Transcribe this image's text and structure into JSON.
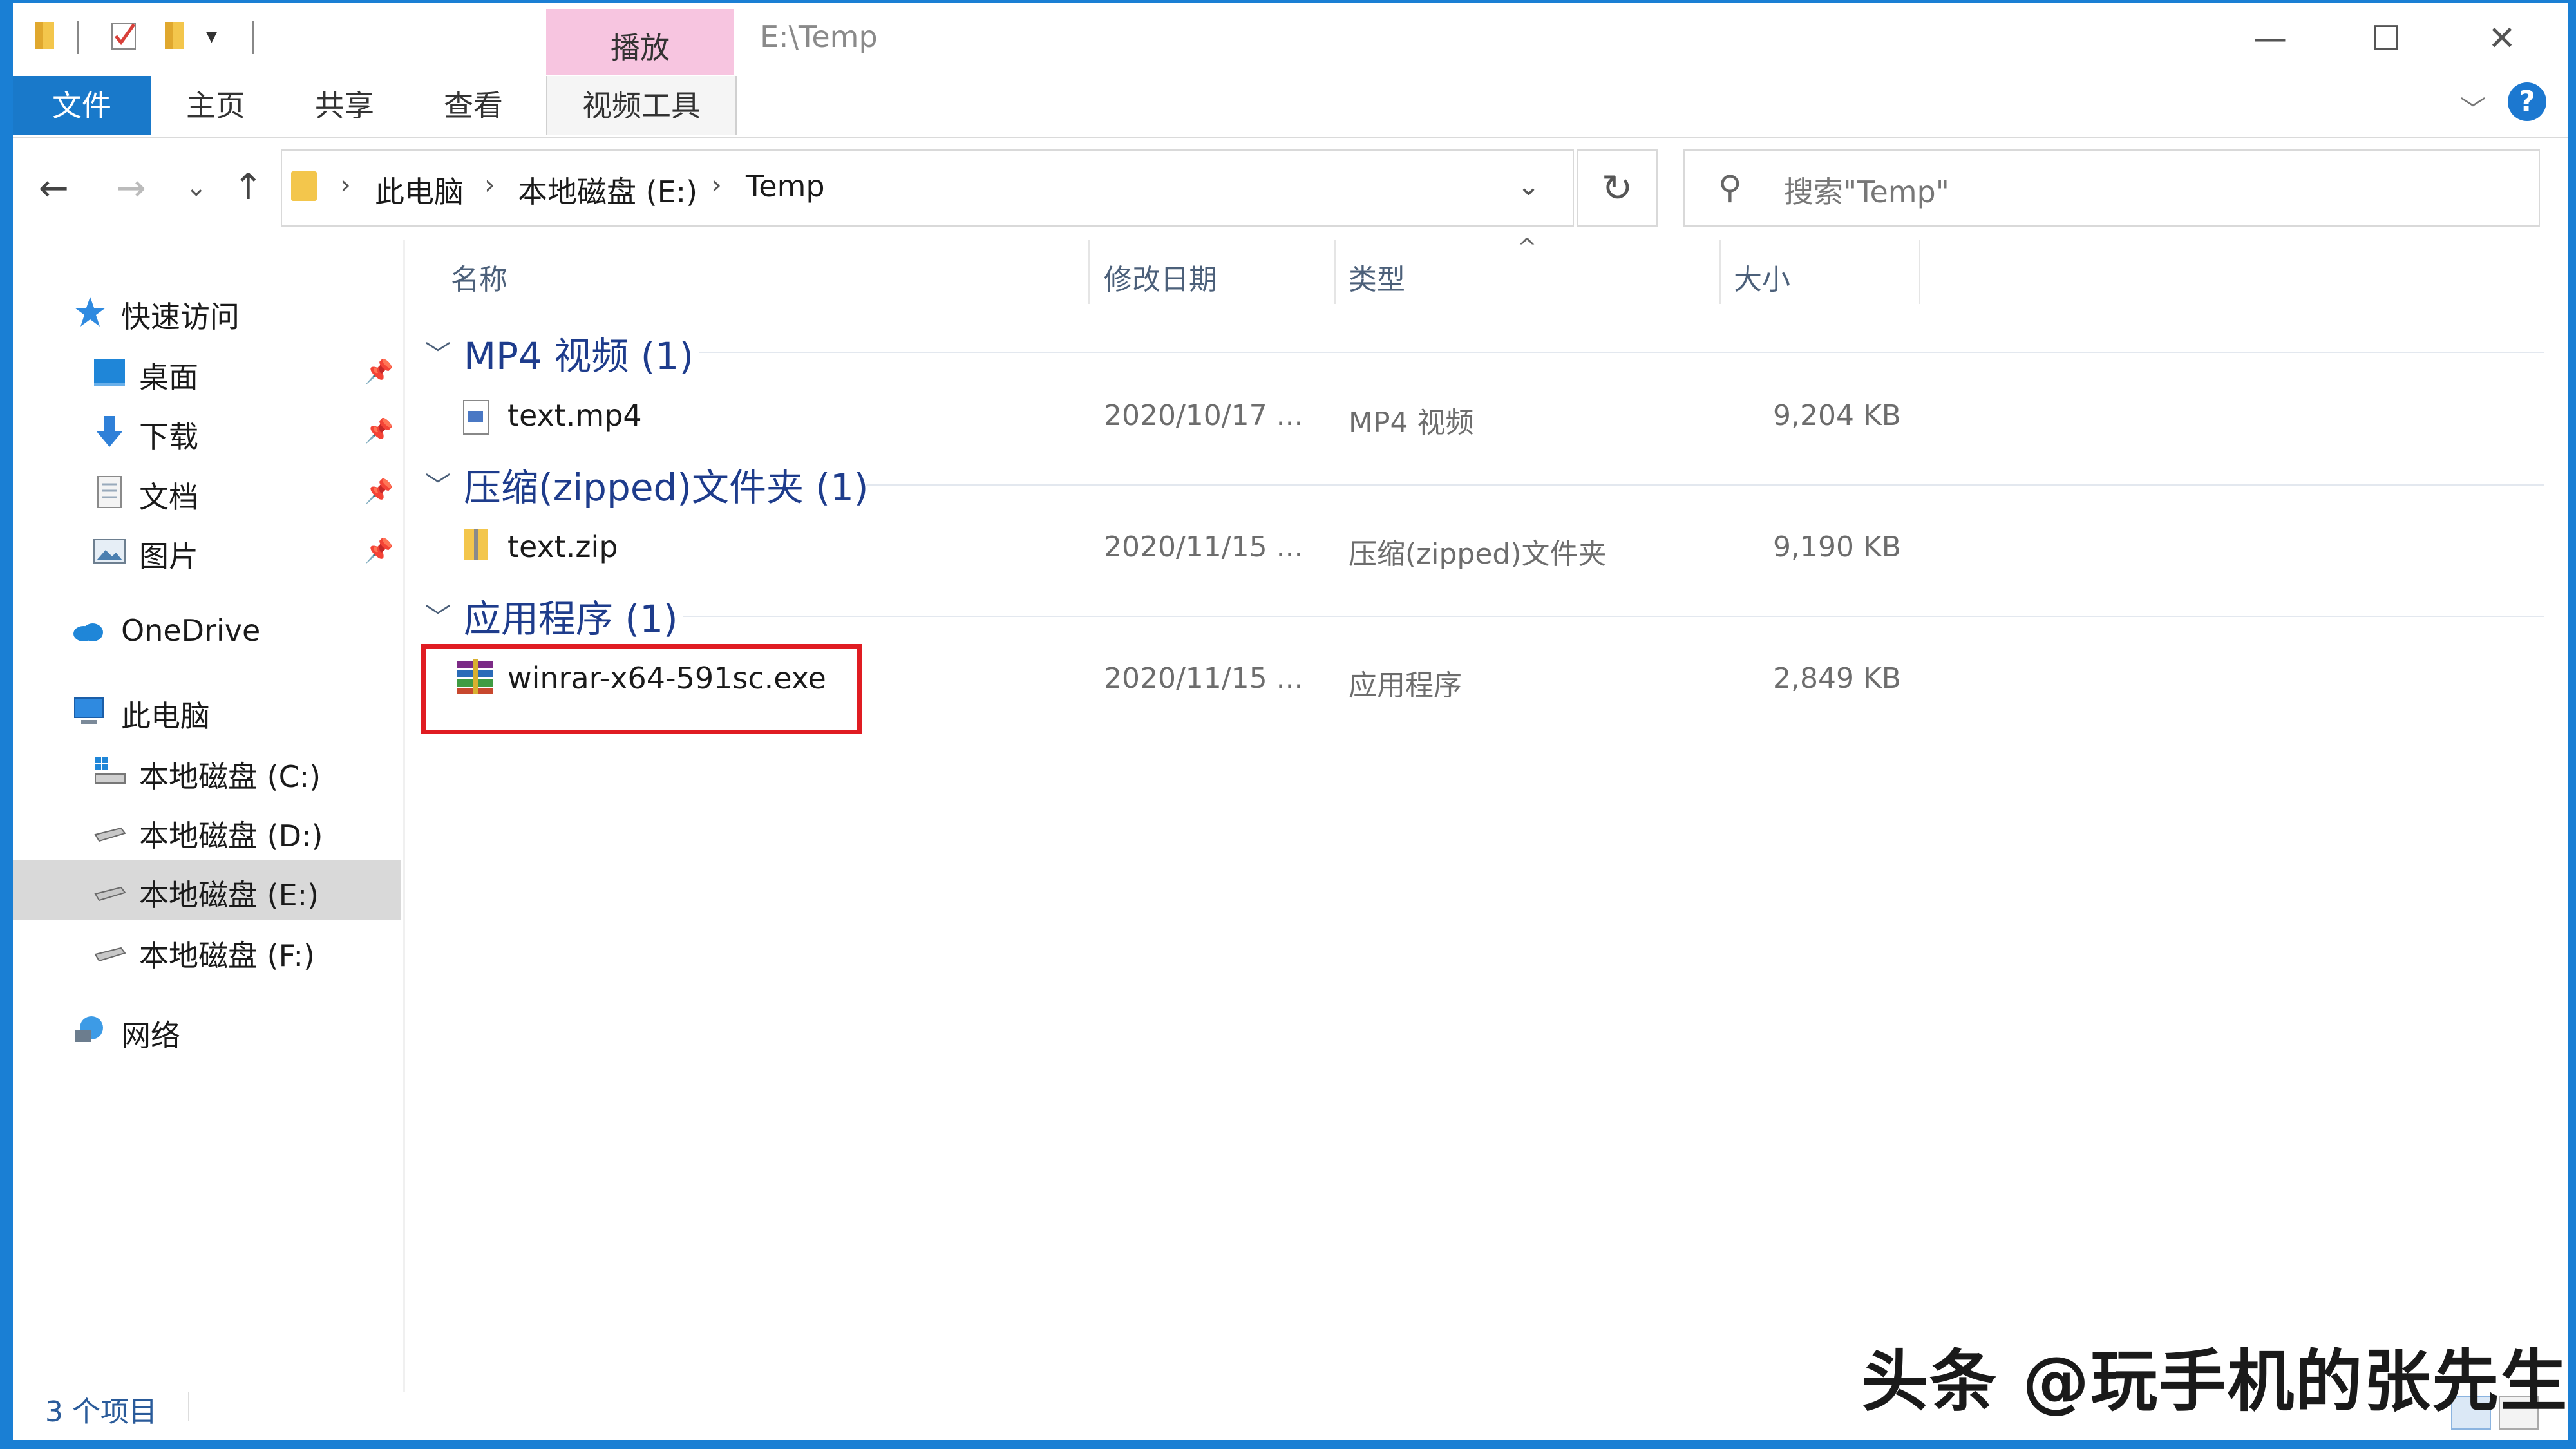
{
  "window": {
    "title": "E:\\Temp",
    "context_tab_header": "播放",
    "controls": {
      "minimize": "—",
      "maximize": "☐",
      "close": "✕"
    }
  },
  "ribbon": {
    "tabs": [
      "文件",
      "主页",
      "共享",
      "查看",
      "视频工具"
    ],
    "expand_glyph": "﹀",
    "help": "?"
  },
  "nav_buttons": {
    "back": "←",
    "forward": "→",
    "recent": "⌄",
    "up": "↑",
    "refresh": "↻",
    "address_dropdown": "⌄"
  },
  "address": {
    "crumbs": [
      "此电脑",
      "本地磁盘 (E:)",
      "Temp"
    ],
    "sep": "›"
  },
  "search": {
    "placeholder": "搜索\"Temp\""
  },
  "sidebar": {
    "items": [
      {
        "label": "快速访问",
        "icon": "star-icon",
        "pinned": false
      },
      {
        "label": "桌面",
        "icon": "desktop-icon",
        "pinned": true
      },
      {
        "label": "下载",
        "icon": "download-icon",
        "pinned": true
      },
      {
        "label": "文档",
        "icon": "document-icon",
        "pinned": true
      },
      {
        "label": "图片",
        "icon": "picture-icon",
        "pinned": true
      },
      {
        "label": "OneDrive",
        "icon": "cloud-icon",
        "pinned": false
      },
      {
        "label": "此电脑",
        "icon": "computer-icon",
        "pinned": false
      },
      {
        "label": "本地磁盘 (C:)",
        "icon": "system-drive-icon",
        "pinned": false
      },
      {
        "label": "本地磁盘 (D:)",
        "icon": "drive-icon",
        "pinned": false
      },
      {
        "label": "本地磁盘 (E:)",
        "icon": "drive-icon",
        "pinned": false,
        "selected": true
      },
      {
        "label": "本地磁盘 (F:)",
        "icon": "drive-icon",
        "pinned": false
      },
      {
        "label": "网络",
        "icon": "network-icon",
        "pinned": false
      }
    ],
    "pin_glyph": "📌"
  },
  "columns": {
    "name": "名称",
    "date": "修改日期",
    "type": "类型",
    "size": "大小",
    "sort_glyph": "^"
  },
  "groups": [
    {
      "title": "MP4 视频 (1)",
      "files": [
        {
          "name": "text.mp4",
          "date": "2020/10/17 ...",
          "type": "MP4 视频",
          "size": "9,204 KB",
          "icon": "video-file-icon"
        }
      ]
    },
    {
      "title": "压缩(zipped)文件夹 (1)",
      "files": [
        {
          "name": "text.zip",
          "date": "2020/11/15 ...",
          "type": "压缩(zipped)文件夹",
          "size": "9,190 KB",
          "icon": "zip-folder-icon"
        }
      ]
    },
    {
      "title": "应用程序 (1)",
      "files": [
        {
          "name": "winrar-x64-591sc.exe",
          "date": "2020/11/15 ...",
          "type": "应用程序",
          "size": "2,849 KB",
          "icon": "winrar-icon"
        }
      ]
    }
  ],
  "group_chevron": "﹀",
  "status": {
    "item_count": "3 个项目"
  },
  "watermark": "头条 @玩手机的张先生",
  "colors": {
    "accent": "#1979ca",
    "context_tab": "#f7c5e0",
    "highlight": "#e01c22",
    "group_title": "#1e3c8c"
  }
}
